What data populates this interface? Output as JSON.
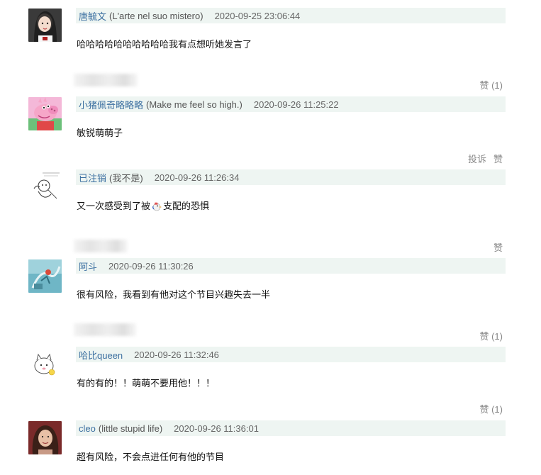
{
  "comments": [
    {
      "username": "唐毓文",
      "user_note": "(L'arte nel suo mistero)",
      "timestamp": "2020-09-25 23:06:44",
      "text": "哈哈哈哈哈哈哈哈哈哈我有点想听她发言了",
      "like_label": "赞 (1)"
    },
    {
      "username": "小猪佩奇略略略",
      "user_note": "(Make me feel so high.)",
      "timestamp": "2020-09-26 11:25:22",
      "text": "敏锐萌萌子",
      "report_label": "投诉",
      "like_label": "赞"
    },
    {
      "username": "已注销",
      "user_note": "(我不是)",
      "timestamp": "2020-09-26 11:26:34",
      "text_before": "又一次感受到了被",
      "text_after": "支配的恐惧",
      "like_label": "赞"
    },
    {
      "username": "阿斗",
      "user_note": "",
      "timestamp": "2020-09-26 11:30:26",
      "text": "很有风险，我看到有他对这个节目兴趣失去一半",
      "like_label": "赞 (1)"
    },
    {
      "username": "哈比queen",
      "user_note": "",
      "timestamp": "2020-09-26 11:32:46",
      "text": "有的有的！！萌萌不要用他！！！",
      "like_label": "赞 (1)"
    },
    {
      "username": "cleo",
      "user_note": "(little stupid life)",
      "timestamp": "2020-09-26 11:36:01",
      "text": "超有风险，不会点进任何有他的节目"
    }
  ],
  "icons": {
    "avatar_1": "avatar-woman-icon",
    "avatar_2": "peppa-pig-avatar-icon",
    "avatar_3": "sketch-avatar-icon",
    "avatar_4": "teal-art-avatar-icon",
    "avatar_5": "cartoon-face-avatar-icon",
    "avatar_6": "avatar-woman-icon",
    "emoji": "rooster-icon"
  }
}
